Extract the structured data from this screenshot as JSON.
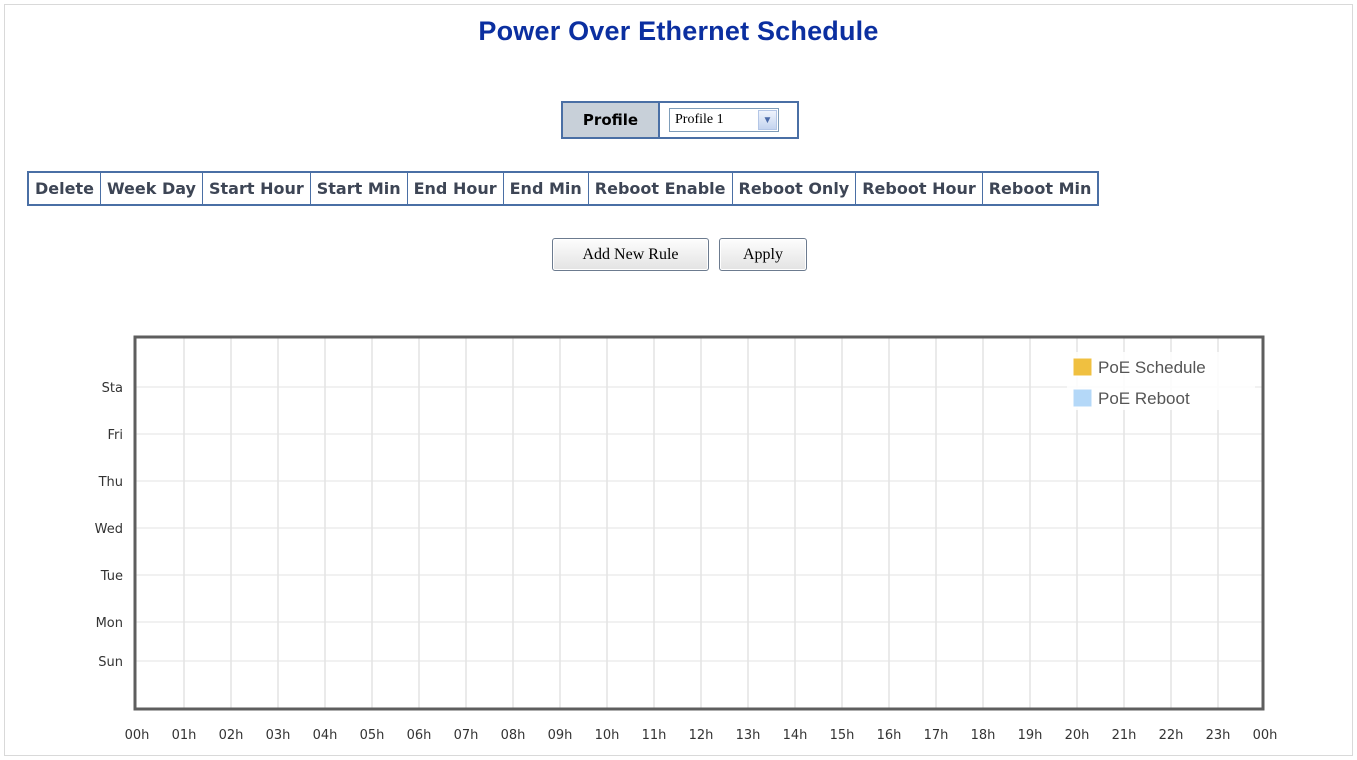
{
  "page": {
    "title": "Power Over Ethernet Schedule"
  },
  "profile": {
    "label": "Profile",
    "selected": "Profile 1"
  },
  "rule_table": {
    "columns": [
      "Delete",
      "Week Day",
      "Start Hour",
      "Start Min",
      "End Hour",
      "End Min",
      "Reboot Enable",
      "Reboot Only",
      "Reboot Hour",
      "Reboot Min"
    ],
    "rows": []
  },
  "buttons": {
    "add_rule": "Add New Rule",
    "apply": "Apply"
  },
  "chart_data": {
    "type": "bar",
    "y_categories": [
      "Sta",
      "Fri",
      "Thu",
      "Wed",
      "Tue",
      "Mon",
      "Sun"
    ],
    "x_ticks": [
      "00h",
      "01h",
      "02h",
      "03h",
      "04h",
      "05h",
      "06h",
      "07h",
      "08h",
      "09h",
      "10h",
      "11h",
      "12h",
      "13h",
      "14h",
      "15h",
      "16h",
      "17h",
      "18h",
      "19h",
      "20h",
      "21h",
      "22h",
      "23h",
      "00h"
    ],
    "xlim": [
      0,
      24
    ],
    "grid": true,
    "legend_position": "top-right",
    "series": [
      {
        "name": "PoE Schedule",
        "color": "#f0c040",
        "values": []
      },
      {
        "name": "PoE Reboot",
        "color": "#b4d8f8",
        "values": []
      }
    ]
  }
}
